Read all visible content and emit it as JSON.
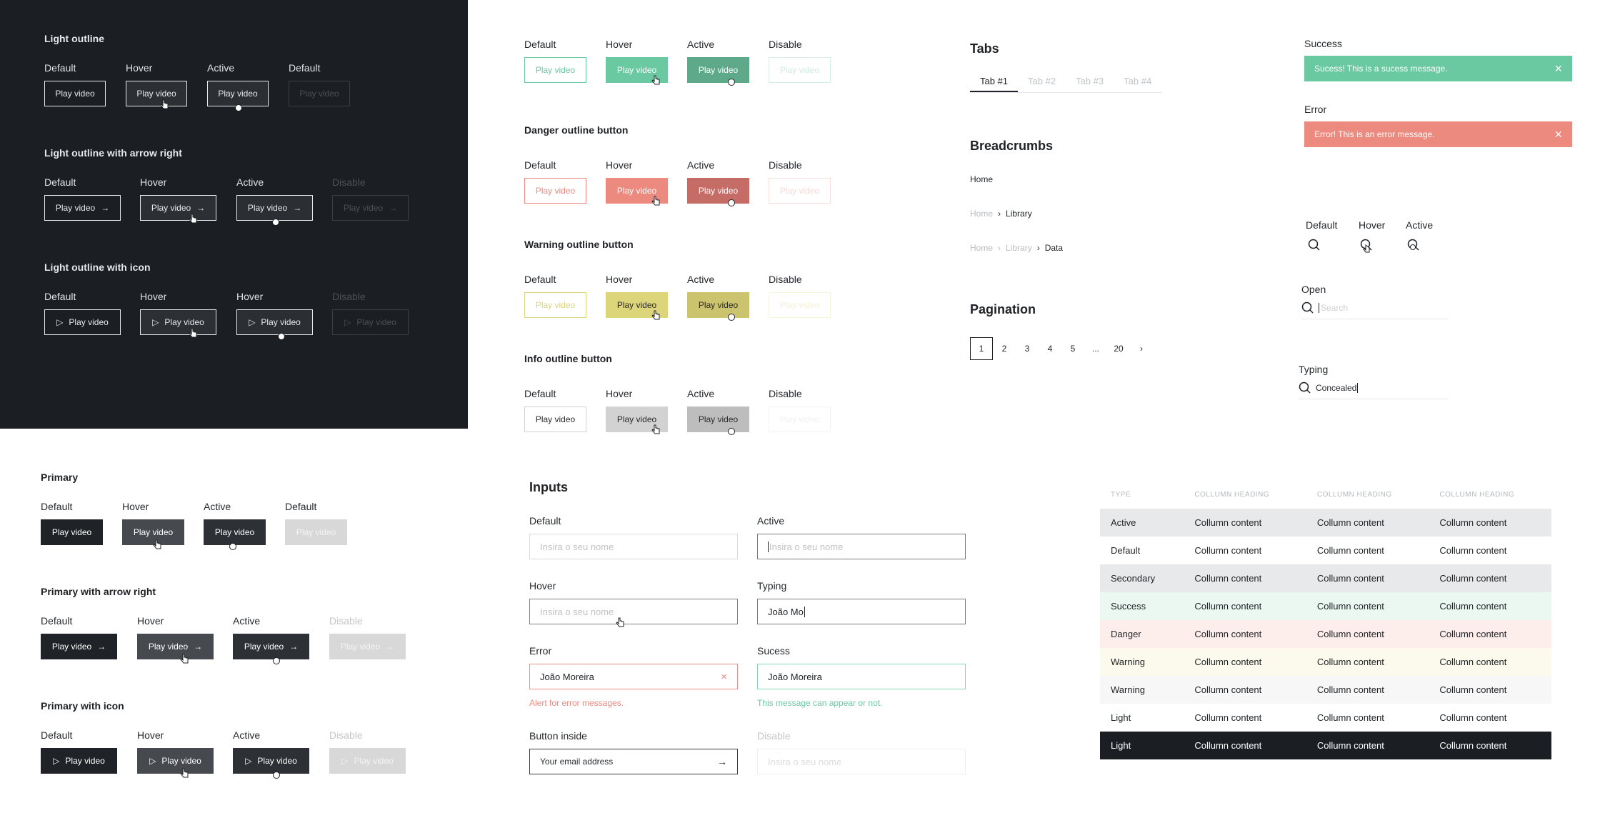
{
  "cta": "Play video",
  "states": {
    "default": "Default",
    "hover": "Hover",
    "active": "Active",
    "disable": "Disable"
  },
  "dark": {
    "s1": "Light outline",
    "s2": "Light outline with arrow right",
    "s3": "Light outline with icon"
  },
  "colored": {
    "danger": "Danger outline button",
    "warning": "Warning outline button",
    "info": "Info outline button"
  },
  "primary": {
    "s1": "Primary",
    "s2": "Primary with arrow right",
    "s3": "Primary with icon"
  },
  "tabs": {
    "title": "Tabs",
    "items": [
      "Tab #1",
      "Tab #2",
      "Tab #3",
      "Tab #4"
    ]
  },
  "breadcrumbs": {
    "title": "Breadcrumbs",
    "home": "Home",
    "library": "Library",
    "data": "Data"
  },
  "pagination": {
    "title": "Pagination",
    "pages": [
      "1",
      "2",
      "3",
      "4",
      "5",
      "...",
      "20"
    ],
    "current": "1"
  },
  "alerts": {
    "success_label": "Success",
    "success_msg": "Sucess! This is a sucess message.",
    "error_label": "Error",
    "error_msg": "Error! This is an error message."
  },
  "search": {
    "open": "Open",
    "typing": "Typing",
    "placeholder": "Search",
    "typed": "Concealed"
  },
  "inputs": {
    "title": "Inputs",
    "placeholder": "Insira o seu nome",
    "typing_label": "Typing",
    "typing_value": "João Mo",
    "error_label": "Error",
    "error_value": "João Moreira",
    "error_note": "Alert for error messages.",
    "success_label": "Sucess",
    "success_value": "João Moreira",
    "success_note": "This message can appear or not.",
    "btn_label": "Button inside",
    "email_placeholder": "Your email address"
  },
  "table": {
    "headers": [
      "TYPE",
      "COLLUMN HEADING",
      "COLLUMN HEADING",
      "COLLUMN HEADING"
    ],
    "cell": "Collumn content",
    "rows": [
      {
        "type": "Active",
        "bg": "#e8e9eb",
        "color": "#1f2226"
      },
      {
        "type": "Default",
        "bg": "#ffffff",
        "color": "#1f2226"
      },
      {
        "type": "Secondary",
        "bg": "#e8e9eb",
        "color": "#1f2226"
      },
      {
        "type": "Success",
        "bg": "#eaf8f1",
        "color": "#1f2226"
      },
      {
        "type": "Danger",
        "bg": "#fdeeec",
        "color": "#1f2226"
      },
      {
        "type": "Warning",
        "bg": "#fbfaec",
        "color": "#1f2226"
      },
      {
        "type": "Warning",
        "bg": "#f7f7f8",
        "color": "#1f2226"
      },
      {
        "type": "Light",
        "bg": "#ffffff",
        "color": "#1f2226"
      },
      {
        "type": "Light",
        "bg": "#1b1e22",
        "color": "#ffffff"
      }
    ]
  },
  "colors": {
    "success": "#6ac9a0",
    "success_dark": "#5fa98b",
    "danger": "#ec8a80",
    "danger_dark": "#c66c66",
    "warning": "#ddd57a",
    "warning_dark": "#cbc36e",
    "info": "#d2d2d2",
    "info_dark": "#bdbdbd"
  }
}
